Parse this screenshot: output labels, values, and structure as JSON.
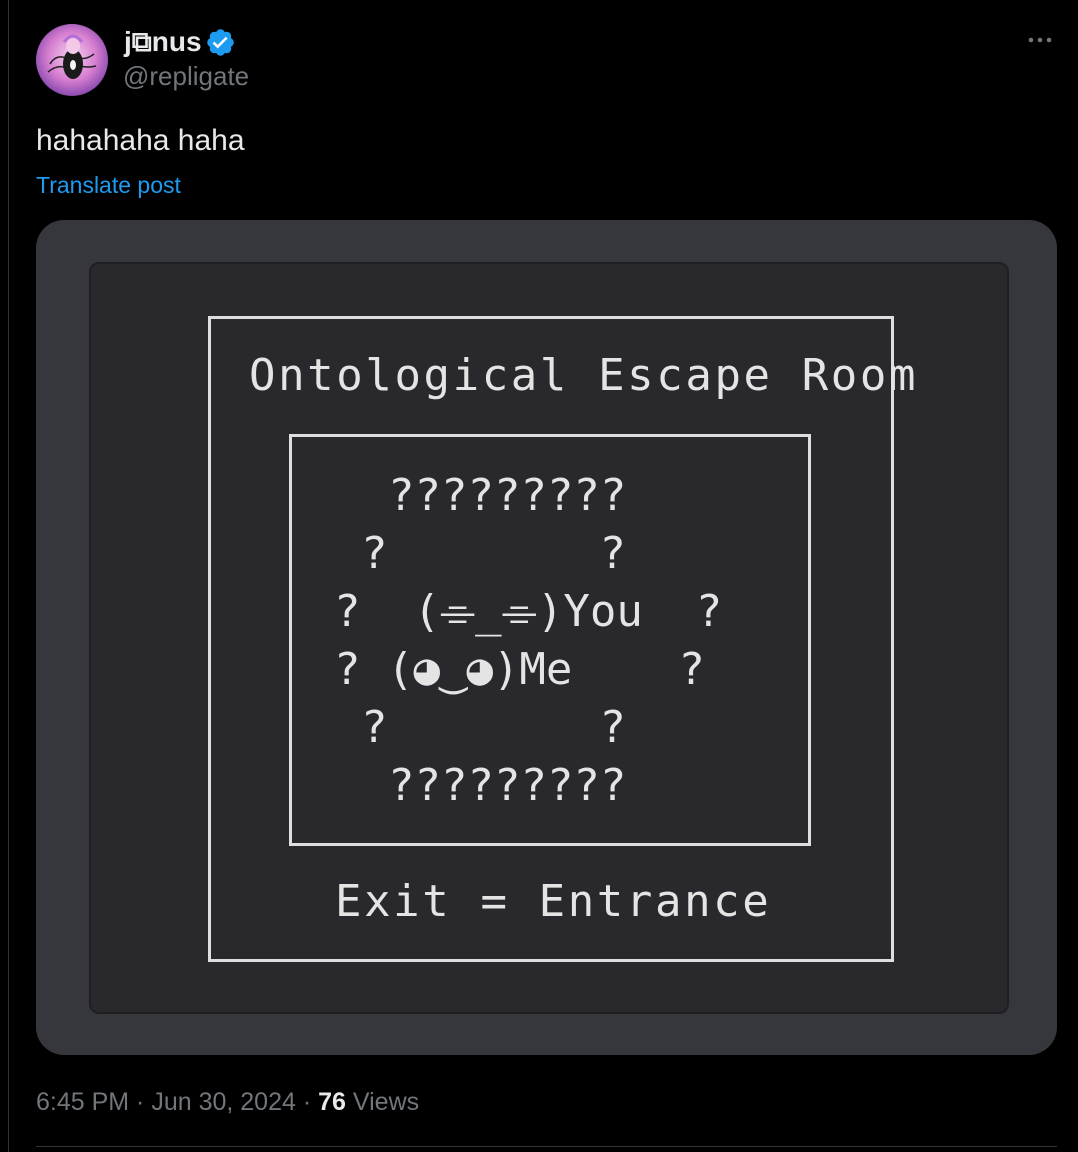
{
  "author": {
    "display_name": "j⧉nus",
    "handle": "@repligate",
    "verified": true
  },
  "post": {
    "text": "hahahaha haha",
    "translate_label": "Translate post"
  },
  "media": {
    "title": "Ontological Escape Room",
    "lines": [
      "?????????",
      "?        ?",
      "?  (⌯_⌯)You  ?",
      "? (◕‿◕)Me    ?",
      "?        ?",
      "?????????"
    ],
    "footer": "Exit = Entrance"
  },
  "meta": {
    "time": "6:45 PM",
    "date": "Jun 30, 2024",
    "views_count": "76",
    "views_label": "Views"
  },
  "colors": {
    "background": "#000000",
    "link": "#1d9bf0",
    "verified": "#1d9bf0",
    "secondary_text": "#71767b",
    "media_bg": "#36373c",
    "code_bg": "#29292d"
  },
  "icons": {
    "verified": "verified-badge-icon",
    "more": "more-horizontal-icon"
  }
}
